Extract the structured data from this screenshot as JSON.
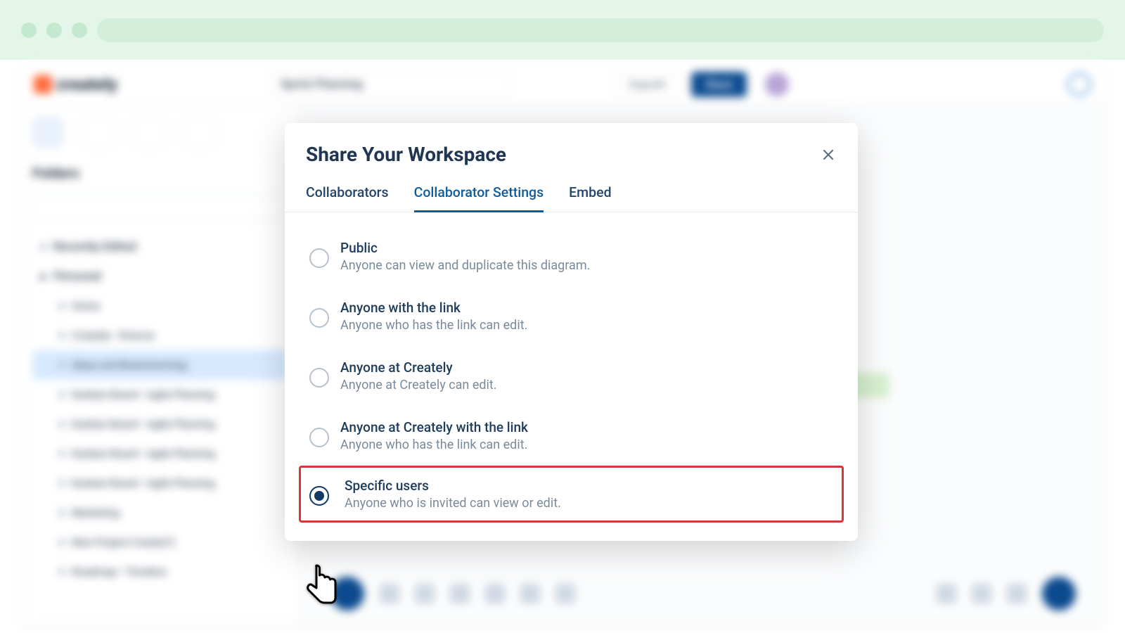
{
  "browser": {},
  "app": {
    "brand_text": "creately",
    "doc_title": "Sprint Planning",
    "export_label": "Export",
    "share_label": "Share",
    "sidebar_heading": "Folders",
    "tree": {
      "recently_edited": "Recently Edited",
      "personal": "Personal",
      "item1": "Home",
      "item2": "Creately • Diverse",
      "item3": "Ideas and Brainstorming",
      "item4": "Kanban Board • Agile Planning",
      "item5": "Kanban Board • Agile Planning",
      "item6": "Kanban Board • Agile Planning",
      "item7": "Kanban Board • Agile Planning",
      "item8": "Marketing",
      "item9": "New Project Create(?)",
      "item10": "Roadmap • Timeline"
    }
  },
  "modal": {
    "title": "Share Your Workspace",
    "tabs": {
      "collaborators": "Collaborators",
      "settings": "Collaborator Settings",
      "embed": "Embed"
    },
    "options": [
      {
        "title": "Public",
        "desc": "Anyone can view and duplicate this diagram."
      },
      {
        "title": "Anyone with the link",
        "desc": "Anyone who has the link can edit."
      },
      {
        "title": "Anyone at Creately",
        "desc": "Anyone at Creately can edit."
      },
      {
        "title": "Anyone at Creately with the link",
        "desc": "Anyone who has the link can edit."
      },
      {
        "title": "Specific users",
        "desc": "Anyone who is invited can view or edit."
      }
    ],
    "selected_index": 4
  }
}
